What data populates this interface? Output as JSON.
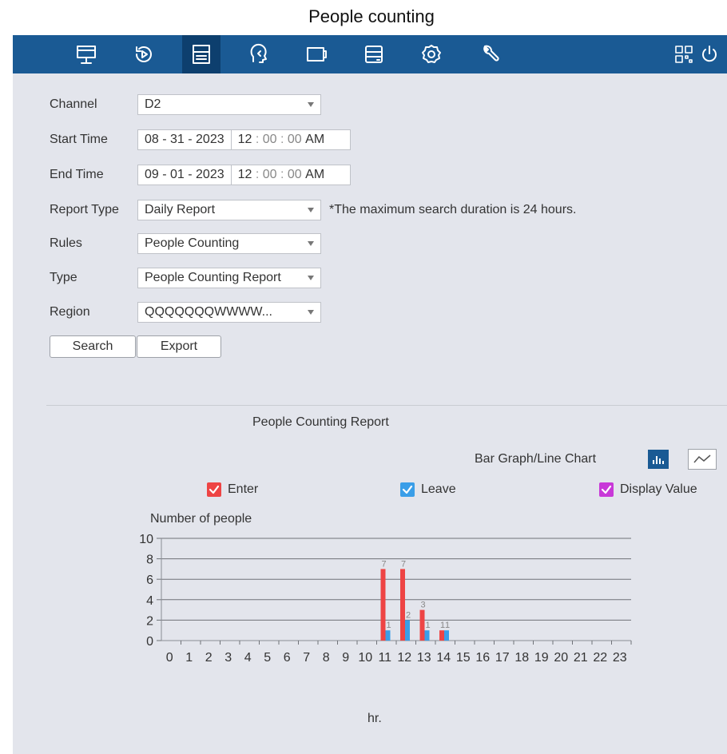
{
  "page_title": "People counting",
  "icons": [
    "live-view-icon",
    "playback-icon",
    "search-icon",
    "ai-icon",
    "camera-icon",
    "storage-icon",
    "settings-icon",
    "maintenance-icon",
    "qr-code-icon",
    "power-icon"
  ],
  "form": {
    "channel": {
      "label": "Channel",
      "value": "D2"
    },
    "start_time": {
      "label": "Start Time",
      "date": "08 - 31 - 2023",
      "h": "12",
      "m": "00",
      "s": "00",
      "ampm": "AM"
    },
    "end_time": {
      "label": "End Time",
      "date": "09 - 01 - 2023",
      "h": "12",
      "m": "00",
      "s": "00",
      "ampm": "AM"
    },
    "report_type": {
      "label": "Report Type",
      "value": "Daily Report",
      "note": "*The maximum search duration is 24 hours."
    },
    "rules": {
      "label": "Rules",
      "value": "People Counting"
    },
    "type": {
      "label": "Type",
      "value": "People Counting Report"
    },
    "region": {
      "label": "Region",
      "value": "QQQQQQQWWWW..."
    }
  },
  "buttons": {
    "search": "Search",
    "export": "Export"
  },
  "report": {
    "title": "People Counting Report",
    "toggle_label": "Bar Graph/Line Chart"
  },
  "legend": {
    "enter": "Enter",
    "leave": "Leave",
    "display_value": "Display Value"
  },
  "colors": {
    "enter": "#ee4444",
    "leave": "#3a9ee8",
    "display_value": "#c838d8",
    "brand": "#1a5a94"
  },
  "chart_data": {
    "type": "bar",
    "ylabel": "Number of people",
    "xlabel": "hr.",
    "ylim": [
      0,
      10
    ],
    "yticks": [
      0,
      2,
      4,
      6,
      8,
      10
    ],
    "categories": [
      "0",
      "1",
      "2",
      "3",
      "4",
      "5",
      "6",
      "7",
      "8",
      "9",
      "10",
      "11",
      "12",
      "13",
      "14",
      "15",
      "16",
      "17",
      "18",
      "19",
      "20",
      "21",
      "22",
      "23"
    ],
    "series": [
      {
        "name": "Enter",
        "values": [
          0,
          0,
          0,
          0,
          0,
          0,
          0,
          0,
          0,
          0,
          0,
          7,
          7,
          3,
          1,
          0,
          0,
          0,
          0,
          0,
          0,
          0,
          0,
          0
        ]
      },
      {
        "name": "Leave",
        "values": [
          0,
          0,
          0,
          0,
          0,
          0,
          0,
          0,
          0,
          0,
          0,
          1,
          2,
          1,
          1,
          0,
          0,
          0,
          0,
          0,
          0,
          0,
          0,
          0
        ]
      }
    ],
    "grid": true
  }
}
